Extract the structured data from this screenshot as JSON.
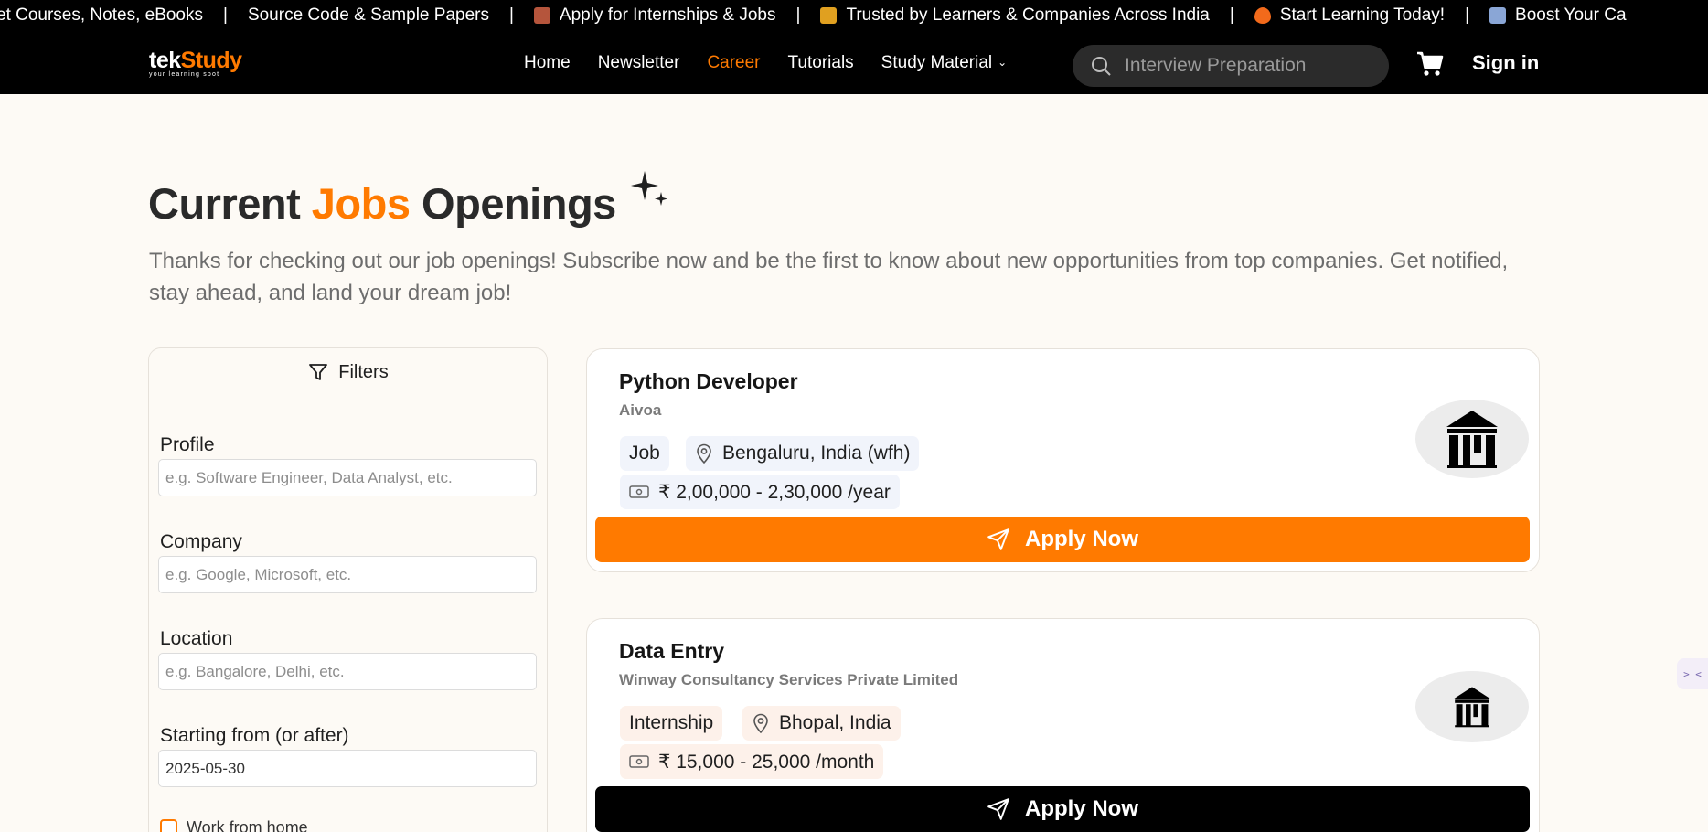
{
  "ticker": {
    "items": [
      {
        "text": "et Courses, Notes, eBooks",
        "emoji_color": ""
      },
      {
        "text": "Source Code & Sample Papers",
        "emoji_color": ""
      },
      {
        "text": "Apply for Internships & Jobs",
        "emoji_color": "#b5553c"
      },
      {
        "text": "Trusted by Learners & Companies Across India",
        "emoji_color": "#e0a020"
      },
      {
        "text": "Start Learning Today!",
        "emoji_color": "#f26a1b"
      },
      {
        "text": "Boost Your Ca",
        "emoji_color": "#8aa6d6"
      }
    ],
    "separator": "|"
  },
  "navbar": {
    "logo_main_a": "tek",
    "logo_main_b": "Study",
    "logo_tagline": "your learning spot",
    "links": [
      {
        "label": "Home",
        "active": false
      },
      {
        "label": "Newsletter",
        "active": false
      },
      {
        "label": "Career",
        "active": true
      },
      {
        "label": "Tutorials",
        "active": false
      },
      {
        "label": "Study Material",
        "active": false
      }
    ],
    "dropdown_chevron": "⌄",
    "search_placeholder": "Interview Preparation",
    "signin": "Sign in"
  },
  "header": {
    "title_part1": "Current ",
    "title_accent": "Jobs",
    "title_part2": " Openings",
    "subtitle": "Thanks for checking out our job openings! Subscribe now and be the first to know about new opportunities from top companies. Get notified, stay ahead, and land your dream job!"
  },
  "filters": {
    "title": "Filters",
    "profile_label": "Profile",
    "profile_placeholder": "e.g. Software Engineer, Data Analyst, etc.",
    "company_label": "Company",
    "company_placeholder": "e.g. Google, Microsoft, etc.",
    "location_label": "Location",
    "location_placeholder": "e.g. Bangalore, Delhi, etc.",
    "start_label": "Starting from (or after)",
    "start_value": "2025-05-30",
    "wfh_label": "Work from home"
  },
  "jobs": [
    {
      "title": "Python Developer",
      "company": "Aivoa",
      "type": "Job",
      "location": "Bengaluru, India (wfh)",
      "salary": "₹ 2,00,000 - 2,30,000 /year",
      "apply_label": "Apply Now",
      "chip_color": "#f1f4fb",
      "button_color": "#ff7a00"
    },
    {
      "title": "Data Entry",
      "company": "Winway Consultancy Services Private Limited",
      "type": "Internship",
      "location": "Bhopal, India",
      "salary": "₹ 15,000 - 25,000 /month",
      "apply_label": "Apply Now",
      "chip_color": "#fdf1ea",
      "button_color": "#000000"
    }
  ],
  "side_widget": {
    "icon": "assistant-icon",
    "text": "> <"
  },
  "colors": {
    "accent": "#ff7a00",
    "background": "#fdfaf5",
    "nav": "#000000"
  }
}
